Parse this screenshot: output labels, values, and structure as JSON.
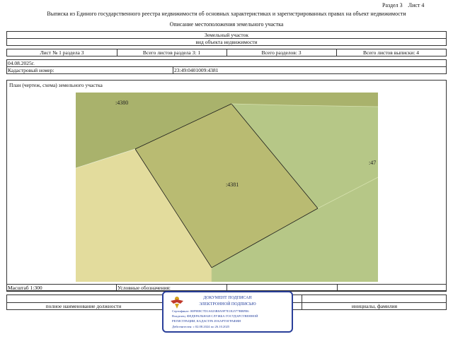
{
  "header": {
    "section_label": "Раздел 3",
    "sheet_label": "Лист 4",
    "title_line1": "Выписка из Единого государственного реестра недвижимости об основных характеристиках и зарегистрированных правах на объект недвижимости",
    "title_line2": "Описание местоположения земельного участка"
  },
  "object": {
    "type": "Земельный участок",
    "type_caption": "вид объекта недвижимости"
  },
  "sheet_info": {
    "sheet_no": "Лист № 1 раздела 3",
    "sheets_in_section": "Всего листов раздела 3: 1",
    "sections_total": "Всего разделов: 3",
    "sheets_total": "Всего листов выписки: 4"
  },
  "date": "04.08.2025г.",
  "cadastral": {
    "label": "Кадастровый номер:",
    "value": "23:49:0401009:4381"
  },
  "plan": {
    "title": "План (чертеж, схема) земельного участка",
    "labels": {
      "neighbor_top": ":4380",
      "parcel": ":4381",
      "neighbor_right": ":47"
    },
    "colors": {
      "neighbor_fill": "#a9b26c",
      "parcel_fill": "#b9bb72",
      "yellow_fill": "#e3dc9d",
      "green_fill": "#b6c787",
      "outline": "#1a1a1a"
    }
  },
  "footer": {
    "scale": "Масштаб 1:300",
    "legend": "Условные обозначения:",
    "position_label": "полное наименование должности",
    "initials_label": "инициалы, фамилия"
  },
  "stamp": {
    "line1": "ДОКУМЕНТ ПОДПИСАН",
    "line2": "ЭЛЕКТРОННОЙ ПОДПИСЬЮ",
    "certificate": "Сертификат: 00F9E8C7D1A023B8A9F7E1E2577BBFB6",
    "owner1": "Владелец: ФЕДЕРАЛЬНАЯ СЛУЖБА ГОСУДАРСТВЕННОЙ",
    "owner2": "РЕГИСТРАЦИИ, КАДАСТРА И КАРТОГРАФИИ",
    "validity": "Действителен: с 02.08.2024 по 26.10.2025",
    "emblem_icon": "eagle-emblem-icon"
  }
}
